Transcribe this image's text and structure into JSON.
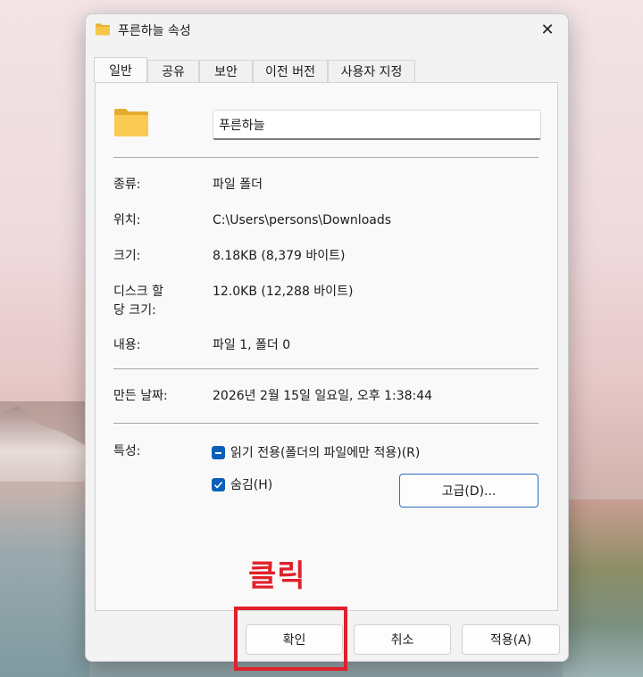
{
  "window": {
    "title": "푸른하늘 속성",
    "close_glyph": "✕"
  },
  "tabs": [
    {
      "label": "일반",
      "active": true
    },
    {
      "label": "공유",
      "active": false
    },
    {
      "label": "보안",
      "active": false
    },
    {
      "label": "이전 버전",
      "active": false
    },
    {
      "label": "사용자 지정",
      "active": false
    }
  ],
  "general": {
    "folder_name": "푸른하늘",
    "type_label": "종류:",
    "type_value": "파일 폴더",
    "location_label": "위치:",
    "location_value": "C:\\Users\\persons\\Downloads",
    "size_label": "크기:",
    "size_value": "8.18KB (8,379 바이트)",
    "disk_size_label_line1": "디스크 할",
    "disk_size_label_line2": "당 크기:",
    "disk_size_value": "12.0KB (12,288 바이트)",
    "contents_label": "내용:",
    "contents_value": "파일 1, 폴더 0",
    "created_label": "만든 날짜:",
    "created_value": "2026년 2월 15일 일요일, 오후 1:38:44",
    "attributes_label": "특성:",
    "readonly_label": "읽기 전용(폴더의 파일에만 적용)(R)",
    "readonly_state": "indeterminate",
    "hidden_label": "숨김(H)",
    "hidden_state": "checked",
    "advanced_button": "고급(D)..."
  },
  "footer": {
    "ok_button": "확인",
    "cancel_button": "취소",
    "apply_button": "적용(A)"
  },
  "annotation": {
    "text": "클릭",
    "color": "#e0202a"
  },
  "colors": {
    "accent": "#0a5fb8",
    "folder": "#f8c74a"
  },
  "icons": {
    "folder": "folder-icon",
    "close": "close-icon",
    "checkbox_partial": "checkbox-indeterminate-icon",
    "checkbox_checked": "checkbox-checked-icon"
  }
}
